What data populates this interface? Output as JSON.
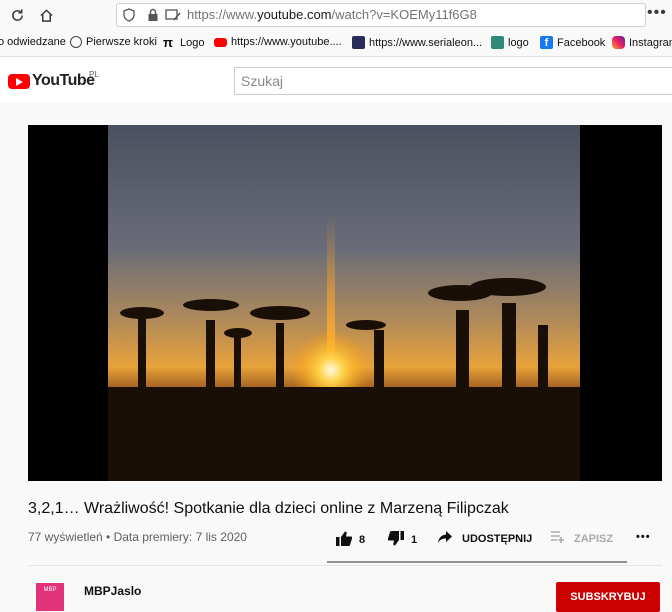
{
  "browser": {
    "url_prefix": "https://www.",
    "url_domain": "youtube.com",
    "url_path": "/watch?v=KOEMy11f6G8",
    "bookmarks": [
      {
        "label": "o odwiedzane",
        "icon": "none"
      },
      {
        "label": "Pierwsze kroki",
        "icon": "globe-icon"
      },
      {
        "label": "Logo",
        "icon": "pi-icon"
      },
      {
        "label": "https://www.youtube....",
        "icon": "youtube-icon"
      },
      {
        "label": "https://www.serialeon...",
        "icon": "site-icon"
      },
      {
        "label": "logo",
        "icon": "image-icon"
      },
      {
        "label": "Facebook",
        "icon": "facebook-icon"
      },
      {
        "label": "Instagram",
        "icon": "instagram-icon"
      }
    ]
  },
  "youtube": {
    "logo_text": "YouTube",
    "region": "PL",
    "search_placeholder": "Szukaj"
  },
  "video": {
    "title": "3,2,1… Wrażliwość! Spotkanie dla dzieci online z Marzeną Filipczak",
    "meta": "77 wyświetleń • Data premiery: 7 lis 2020",
    "likes": "8",
    "dislikes": "1",
    "share_label": "UDOSTĘPNIJ",
    "save_label": "ZAPISZ",
    "more_label": "•••"
  },
  "channel": {
    "name": "MBPJaslo",
    "avatar_text": "MBP",
    "subscribe_label": "SUBSKRYBUJ"
  },
  "colors": {
    "youtube_red": "#ff0000",
    "subscribe_red": "#cc0000"
  }
}
